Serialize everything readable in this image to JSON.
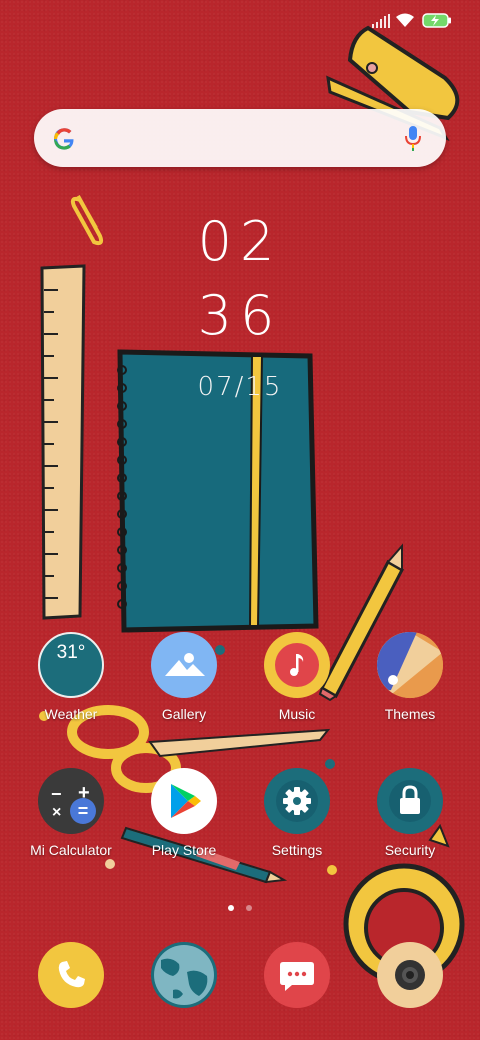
{
  "status_bar": {
    "battery_icon": "battery-charging-icon",
    "wifi_icon": "wifi-icon",
    "signal_icon": "signal-icon"
  },
  "search": {
    "logo": "google-logo",
    "mic_icon": "mic-icon"
  },
  "clock": {
    "hour": "02",
    "minute": "36",
    "date": "07/15"
  },
  "apps": [
    {
      "label": "Weather",
      "badge": "31°",
      "icon": "weather-icon"
    },
    {
      "label": "Gallery",
      "icon": "gallery-icon"
    },
    {
      "label": "Music",
      "icon": "music-icon"
    },
    {
      "label": "Themes",
      "icon": "themes-icon"
    },
    {
      "label": "Mi Calculator",
      "icon": "calculator-icon"
    },
    {
      "label": "Play Store",
      "icon": "play-store-icon"
    },
    {
      "label": "Settings",
      "icon": "settings-icon"
    },
    {
      "label": "Security",
      "icon": "security-icon"
    }
  ],
  "page_indicator": {
    "count": 2,
    "active": 0
  },
  "dock": [
    {
      "name": "phone",
      "icon": "phone-icon"
    },
    {
      "name": "browser",
      "icon": "globe-icon"
    },
    {
      "name": "messages",
      "icon": "message-icon"
    },
    {
      "name": "camera",
      "icon": "camera-icon"
    }
  ],
  "colors": {
    "wallpaper": "#b9262c",
    "teal": "#1c6d7b",
    "yellow": "#f1c84b"
  }
}
